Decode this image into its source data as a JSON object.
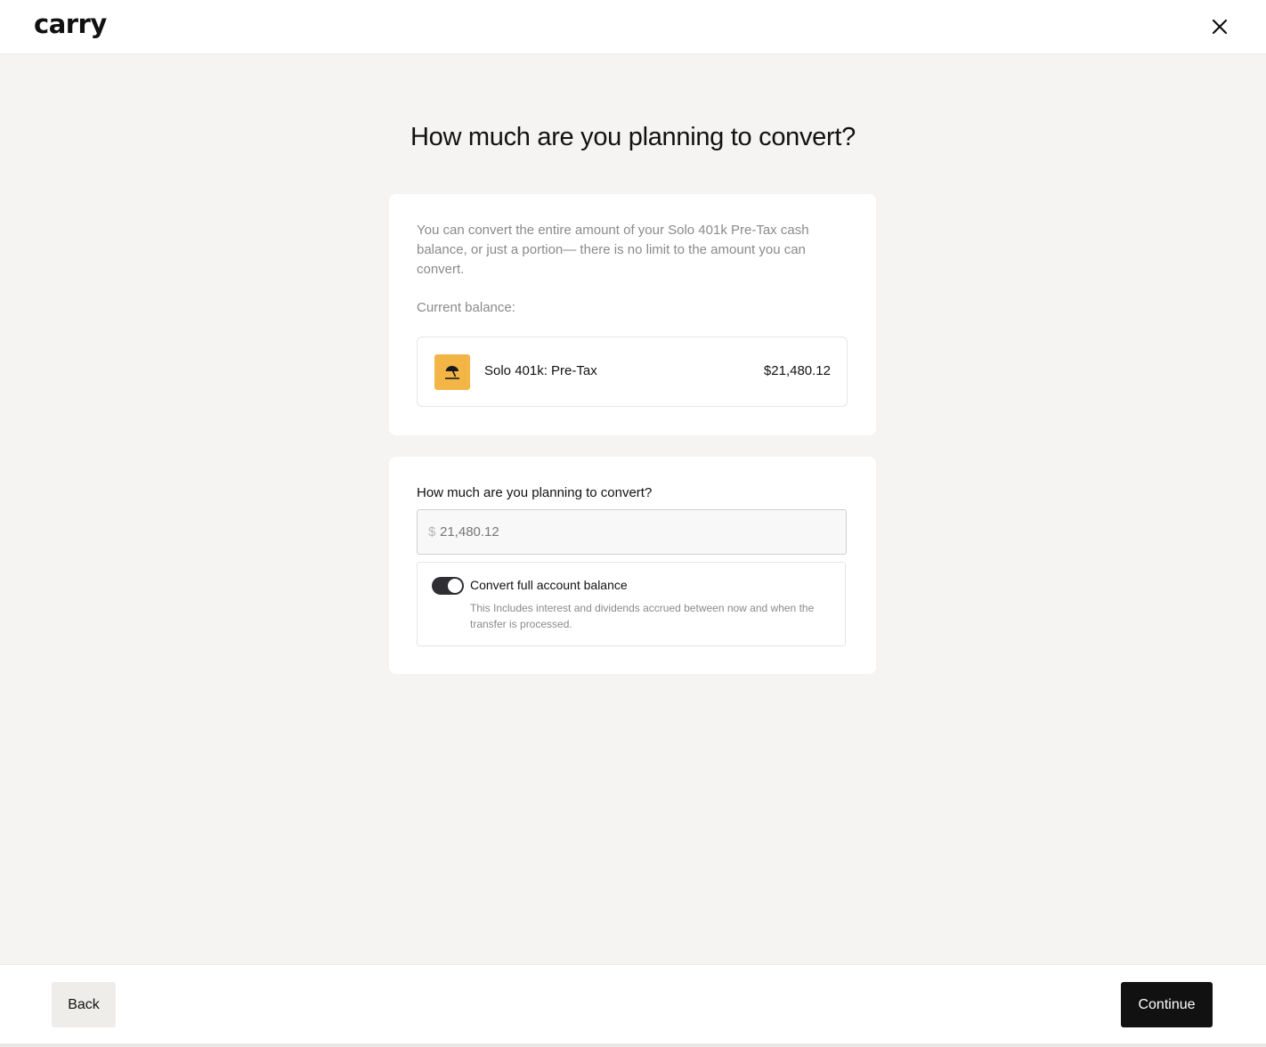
{
  "header": {
    "logo": "carry",
    "close_icon": "close-icon"
  },
  "page": {
    "title": "How much are you planning to convert?"
  },
  "balance_card": {
    "description": "You can convert the entire amount of your Solo 401k Pre-Tax cash balance, or just a portion— there is no limit to the amount you can convert.",
    "current_balance_label": "Current balance:",
    "account": {
      "icon": "beach-umbrella-icon",
      "name": "Solo 401k: Pre-Tax",
      "amount": "$21,480.12"
    }
  },
  "convert_card": {
    "question": "How much are you planning to convert?",
    "currency_symbol": "$",
    "amount_value": "21,480.12",
    "toggle": {
      "state": "on",
      "label": "Convert full account balance",
      "help": "This Includes interest and dividends accrued between now and when the transfer is processed."
    }
  },
  "footer": {
    "back_label": "Back",
    "continue_label": "Continue"
  },
  "colors": {
    "accent_icon_bg": "#f4b547",
    "primary_button": "#111111",
    "toggle_on": "#2e2e33"
  }
}
